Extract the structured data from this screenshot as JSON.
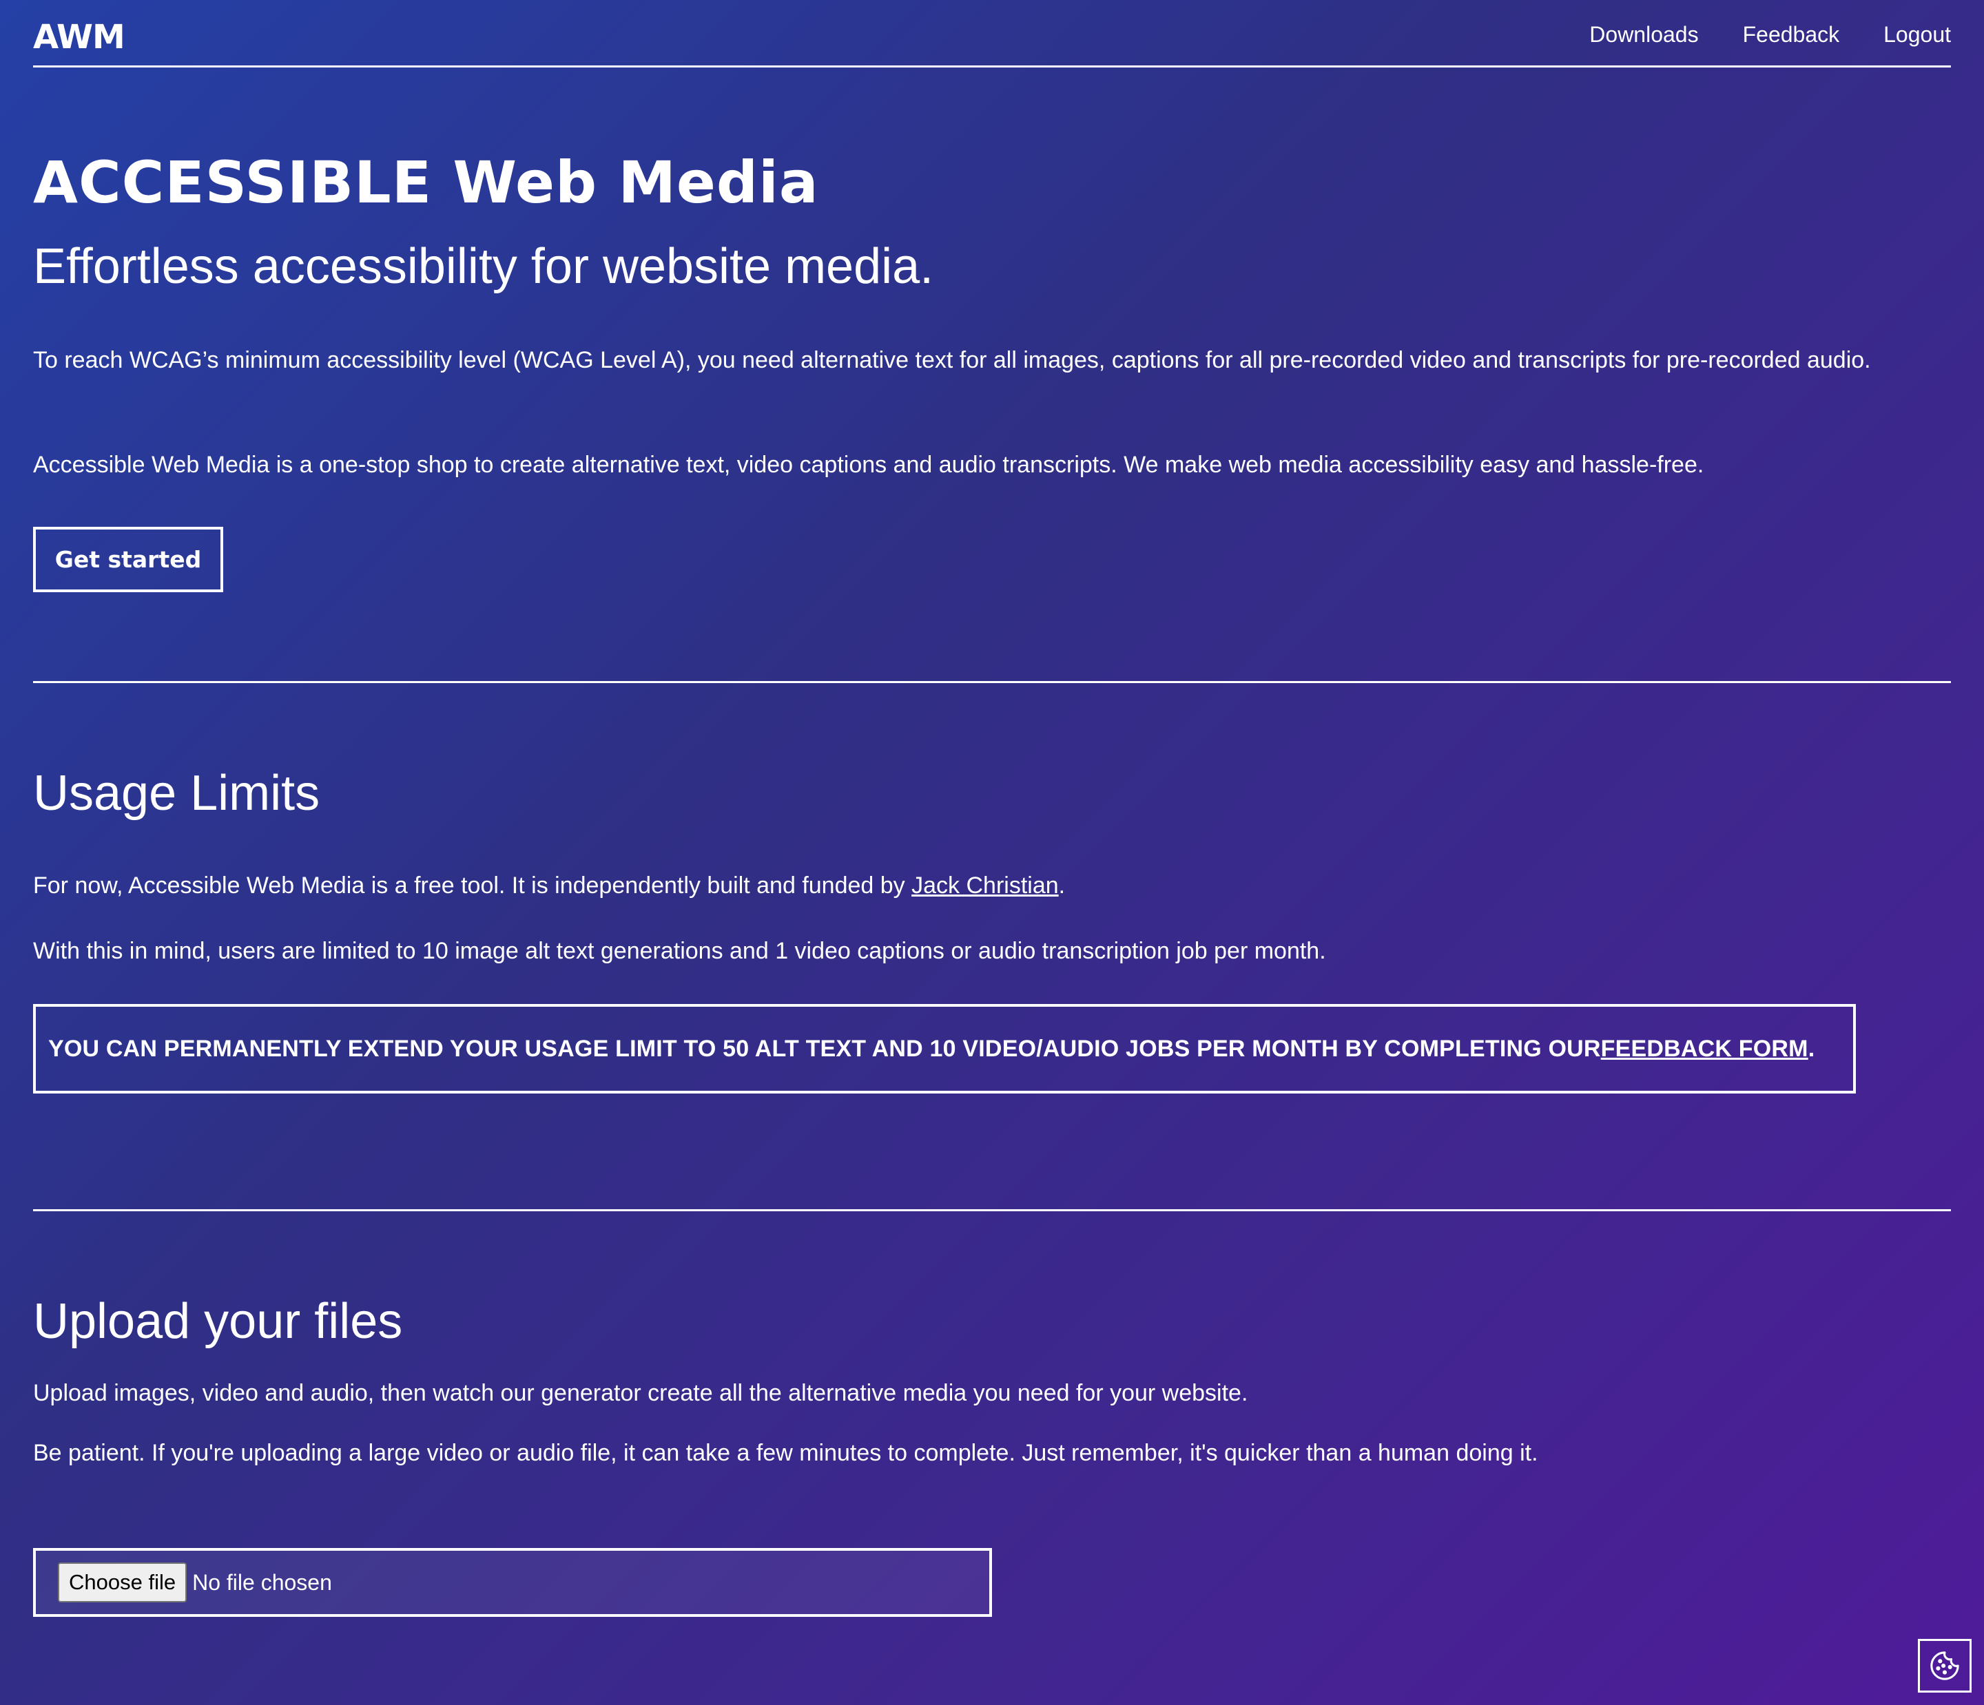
{
  "header": {
    "logo": "AWM",
    "nav": {
      "downloads": "Downloads",
      "feedback": "Feedback",
      "logout": "Logout"
    }
  },
  "hero": {
    "brand": "ACCESSIBLE Web Media",
    "tagline": "Effortless accessibility for website media.",
    "para1": "To reach WCAG’s minimum accessibility level (WCAG Level A), you need alternative text for all images, captions for all pre-recorded video and transcripts for pre-recorded audio.",
    "para2": "Accessible Web Media is a one-stop shop to create alternative text, video captions and audio transcripts. We make web media accessibility easy and hassle-free.",
    "cta": "Get started"
  },
  "usage": {
    "title": "Usage Limits",
    "para1_prefix": "For now, Accessible Web Media is a free tool. It is independently built and funded by ",
    "para1_link": "Jack Christian",
    "para1_suffix": ".",
    "para2": "With this in mind, users are limited to 10 image alt text generations and 1 video captions or audio transcription job per month.",
    "notice_prefix": "YOU CAN PERMANENTLY EXTEND YOUR USAGE LIMIT TO 50 ALT TEXT AND 10 VIDEO/AUDIO JOBS PER MONTH BY COMPLETING OUR ",
    "notice_link": "FEEDBACK FORM",
    "notice_suffix": "."
  },
  "upload": {
    "title": "Upload your files",
    "para1": "Upload images, video and audio, then watch our generator create all the alternative media you need for your website.",
    "para2": "Be patient. If you're uploading a large video or audio file, it can take a few minutes to complete. Just remember, it's quicker than a human doing it.",
    "choose_label": "Choose file",
    "file_status": "No file chosen"
  },
  "icons": {
    "cookie": "cookie-icon"
  },
  "colors": {
    "text": "#ffffff",
    "gradient_start": "#2540a6",
    "gradient_end": "#4f1b99"
  }
}
